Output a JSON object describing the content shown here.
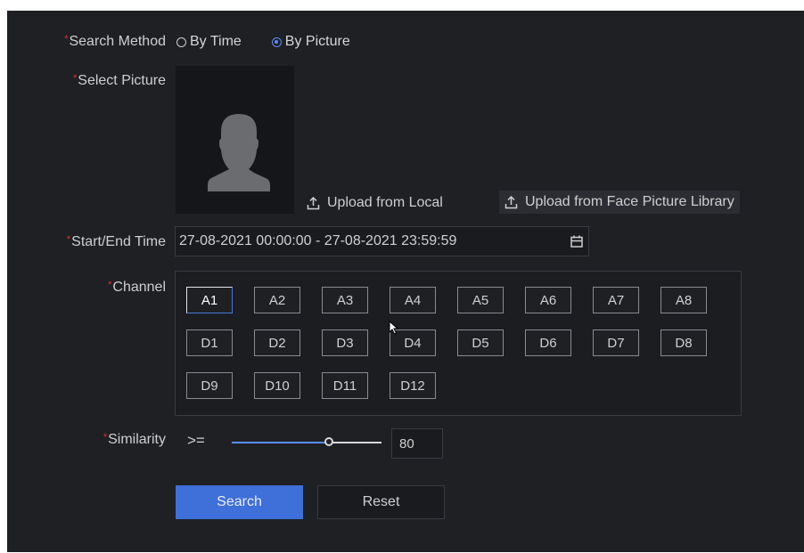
{
  "colors": {
    "accent": "#3f6fd8",
    "required": "#d33333",
    "background": "#1f2024"
  },
  "search_method": {
    "label": "Search Method",
    "options": [
      {
        "label": "By Time",
        "selected": false
      },
      {
        "label": "By Picture",
        "selected": true
      }
    ]
  },
  "select_picture": {
    "label": "Select Picture",
    "placeholder_icon": "person-silhouette-icon",
    "upload_local": "Upload from Local",
    "upload_library": "Upload from Face Picture Library"
  },
  "start_end_time": {
    "label": "Start/End Time",
    "value": "27-08-2021 00:00:00 - 27-08-2021 23:59:59",
    "icon": "calendar-icon"
  },
  "channel": {
    "label": "Channel",
    "items": [
      "A1",
      "A2",
      "A3",
      "A4",
      "A5",
      "A6",
      "A7",
      "A8",
      "D1",
      "D2",
      "D3",
      "D4",
      "D5",
      "D6",
      "D7",
      "D8",
      "D9",
      "D10",
      "D11",
      "D12"
    ],
    "selected": "A1"
  },
  "similarity": {
    "label": "Similarity",
    "operator": ">=",
    "value": "80",
    "slider_fraction": 0.65
  },
  "buttons": {
    "search": "Search",
    "reset": "Reset"
  }
}
